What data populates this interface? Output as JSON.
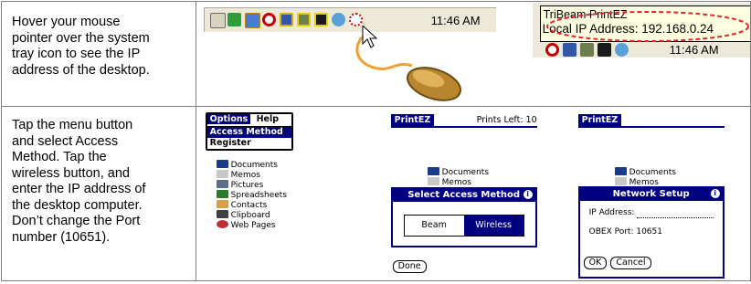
{
  "steps": [
    {
      "text": "Hover your mouse\npointer over the system\ntray icon to see the IP\naddress of the desktop."
    },
    {
      "text": "Tap the menu button\nand select Access\nMethod.  Tap the\nwireless button, and\nenter the IP address of\nthe desktop computer.\nDon’t change the Port\nnumber (10651)."
    }
  ],
  "taskbar": {
    "clock": "11:46 AM",
    "tray_icons": [
      "speaker-icon",
      "network-icon",
      "monitor-icon",
      "sync-icon",
      "display-icon",
      "scanner-icon",
      "camera-icon",
      "tribeam-icon",
      "antivirus-icon"
    ]
  },
  "tooltip": {
    "title": "TriBeam PrintEZ",
    "ip_line": "Local IP Address: 192.168.0.24",
    "clock_partial": "11:46 AM"
  },
  "colors": {
    "palm_header": "#000080",
    "highlight_ellipse": "#e8212e",
    "tray_bg": "#ece9d8"
  },
  "screen1": {
    "menu_tabs": [
      "Options",
      "Help"
    ],
    "menu_items": [
      "Access Method",
      "Register"
    ],
    "documents": [
      "Documents",
      "Memos",
      "Pictures",
      "Spreadsheets",
      "Contacts",
      "Clipboard",
      "Web Pages"
    ]
  },
  "screen2": {
    "app_title": "PrintEZ",
    "prints_left": "Prints Left: 10",
    "documents": [
      "Documents",
      "Memos"
    ],
    "dialog_title": "Select Access Method",
    "options": [
      "Beam",
      "Wireless"
    ],
    "selected": "Wireless",
    "done_label": "Done"
  },
  "screen3": {
    "app_title": "PrintEZ",
    "documents": [
      "Documents",
      "Memos"
    ],
    "dialog_title": "Network Setup",
    "ip_label": "IP Address:",
    "port_label": "OBEX Port: 10651",
    "ok_label": "OK",
    "cancel_label": "Cancel"
  }
}
